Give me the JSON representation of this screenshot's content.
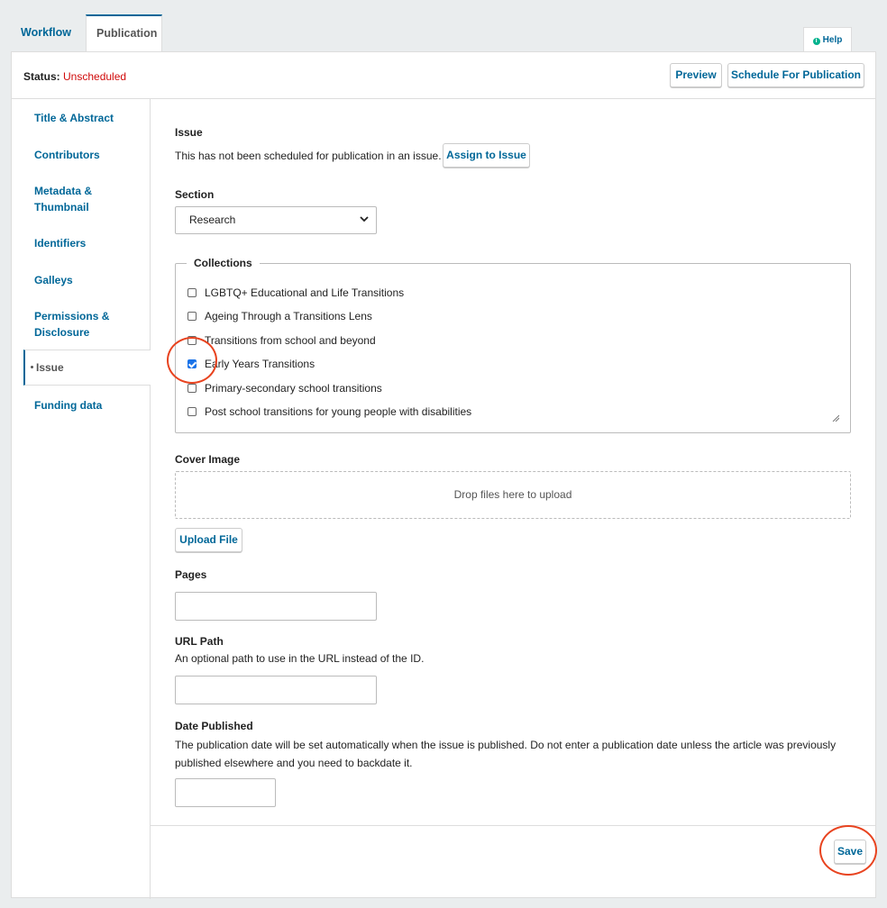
{
  "tabs": {
    "workflow": "Workflow",
    "publication": "Publication",
    "help": "Help"
  },
  "status": {
    "label": "Status:",
    "value": "Unscheduled"
  },
  "header_actions": {
    "preview": "Preview",
    "schedule": "Schedule For Publication"
  },
  "sidebar": {
    "items": [
      {
        "label": "Title & Abstract"
      },
      {
        "label": "Contributors"
      },
      {
        "label": "Metadata & Thumbnail"
      },
      {
        "label": "Identifiers"
      },
      {
        "label": "Galleys"
      },
      {
        "label": "Permissions & Disclosure"
      },
      {
        "label": "Issue"
      },
      {
        "label": "Funding data"
      }
    ]
  },
  "issue": {
    "heading": "Issue",
    "description": "This has not been scheduled for publication in an issue.",
    "assign_button": "Assign to Issue"
  },
  "section": {
    "label": "Section",
    "selected": "Research"
  },
  "collections": {
    "legend": "Collections",
    "items": [
      {
        "label": "LGBTQ+ Educational and Life Transitions",
        "checked": false
      },
      {
        "label": "Ageing Through a Transitions Lens",
        "checked": false
      },
      {
        "label": "Transitions from school and beyond",
        "checked": false
      },
      {
        "label": "Early Years Transitions",
        "checked": true
      },
      {
        "label": "Primary-secondary school transitions",
        "checked": false
      },
      {
        "label": "Post school transitions for young people with disabilities",
        "checked": false
      }
    ]
  },
  "cover_image": {
    "label": "Cover Image",
    "dropzone": "Drop files here to upload",
    "upload_button": "Upload File"
  },
  "pages": {
    "label": "Pages",
    "value": ""
  },
  "url_path": {
    "label": "URL Path",
    "description": "An optional path to use in the URL instead of the ID.",
    "value": ""
  },
  "date_published": {
    "label": "Date Published",
    "description": "The publication date will be set automatically when the issue is published. Do not enter a publication date unless the article was previously published elsewhere and you need to backdate it.",
    "value": ""
  },
  "footer": {
    "save": "Save"
  },
  "colors": {
    "link": "#006798",
    "status_red": "#d00a0a",
    "annotation": "#e8431f",
    "checkbox": "#1a73e8"
  }
}
